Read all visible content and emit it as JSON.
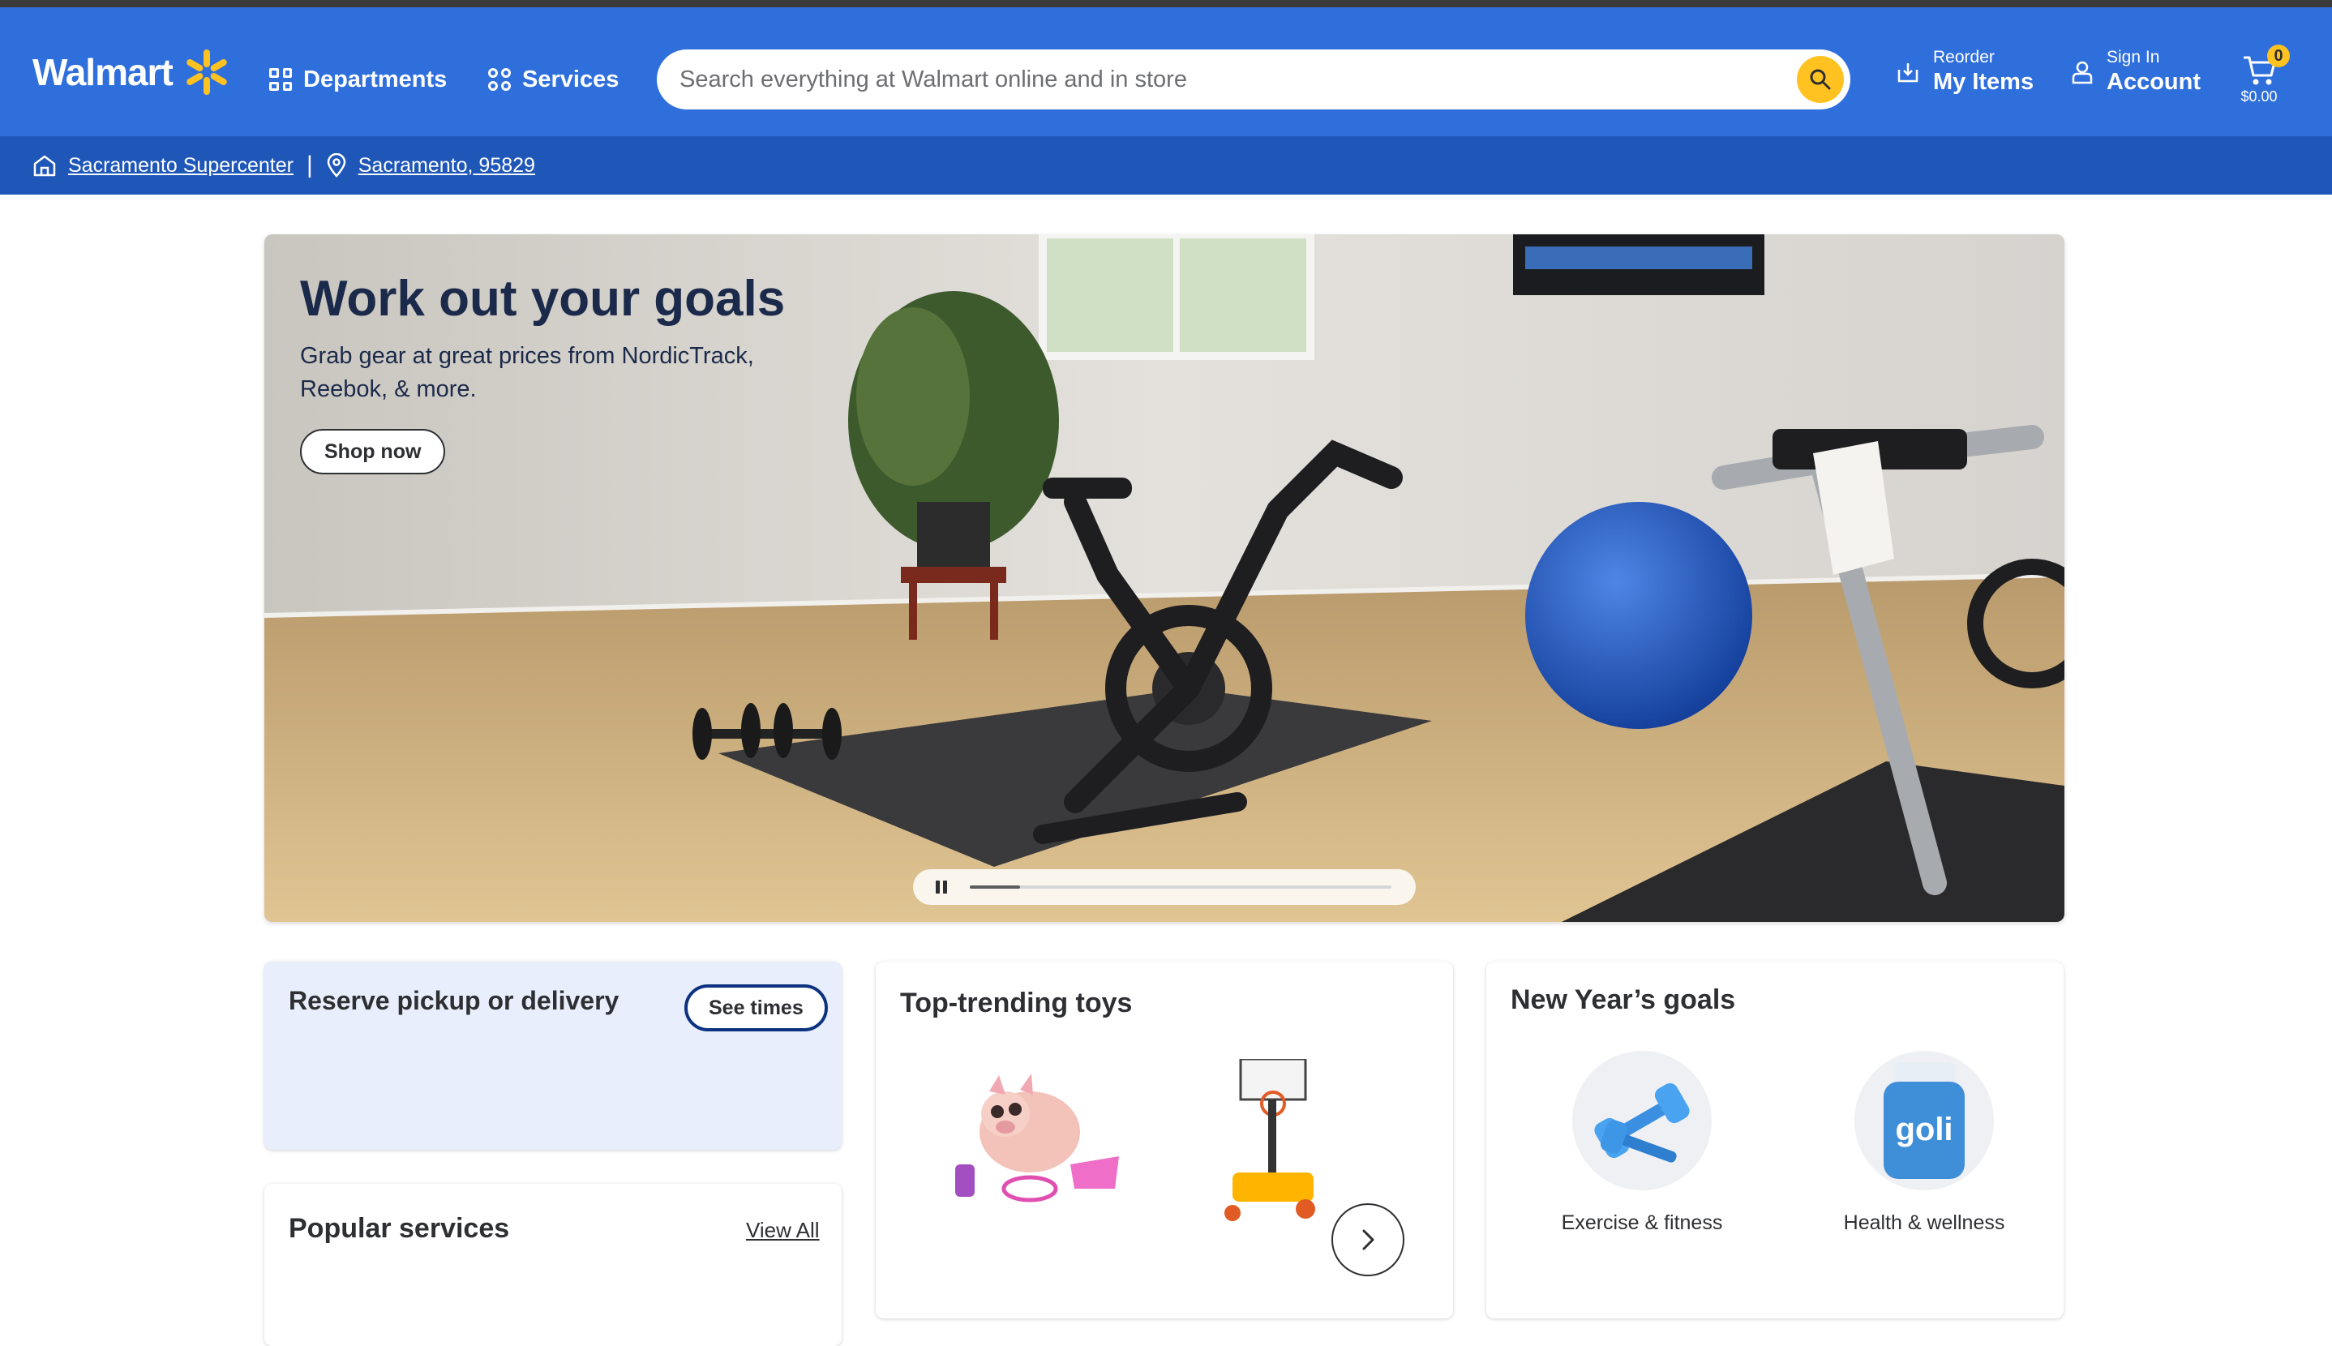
{
  "header": {
    "logo_text": "Walmart",
    "departments_label": "Departments",
    "services_label": "Services",
    "search_placeholder": "Search everything at Walmart online and in store",
    "reorder_small": "Reorder",
    "reorder_big": "My Items",
    "signin_small": "Sign In",
    "signin_big": "Account",
    "cart_count": "0",
    "cart_total": "$0.00",
    "brand_color": "#2f6fdc",
    "accent_color": "#ffc220"
  },
  "location": {
    "store": "Sacramento Supercenter",
    "separator": "|",
    "zip": "Sacramento, 95829"
  },
  "hero": {
    "title": "Work out your goals",
    "subtitle": "Grab gear at great prices from NordicTrack, Reebok, & more.",
    "button_label": "Shop now",
    "carousel_progress": 0.12
  },
  "reserve": {
    "title": "Reserve pickup or delivery",
    "button_label": "See times"
  },
  "popular": {
    "title": "Popular services",
    "link_label": "View All"
  },
  "toys": {
    "title": "Top-trending toys"
  },
  "goals": {
    "title": "New Year’s goals",
    "items": [
      {
        "label": "Exercise & fitness",
        "icon": "dumbbell-image"
      },
      {
        "label": "Health & wellness",
        "icon": "gummies-jar-image"
      }
    ]
  }
}
